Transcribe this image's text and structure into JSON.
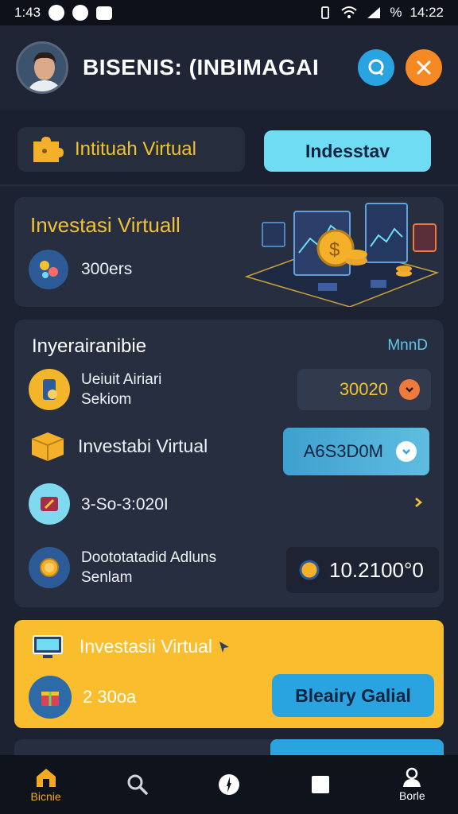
{
  "status_bar": {
    "time_left": "1:43",
    "battery": "%",
    "time_right": "14:22"
  },
  "header": {
    "title": "BISENIS: (INBIMAGAI"
  },
  "tabs": {
    "left_label": "Intituah Virtual",
    "right_label": "Indesstav"
  },
  "hero": {
    "title": "Investasi Virtuall",
    "stat": "300ers"
  },
  "panel": {
    "title": "Inyerairanibie",
    "link": "MnnD",
    "rows": [
      {
        "line1": "Ueiuit Airiari",
        "line2": "Sekiom",
        "value": "30020"
      },
      {
        "label": "Investabi Virtual",
        "value": "A6S3D0M"
      },
      {
        "label": "3-So-3:020I"
      },
      {
        "line1": "Doototatadid Adluns",
        "line2": "Senlam",
        "value": "10.2100°0"
      }
    ]
  },
  "promo": {
    "title": "Investasii Virtual",
    "value": "2 30oa",
    "button": "Bleairy Galial"
  },
  "nav": {
    "home": "Bicnie",
    "search": "",
    "compass": "",
    "square": "",
    "profile": "Borle"
  },
  "colors": {
    "accent_yellow": "#f2c232",
    "accent_cyan": "#6fdcf3",
    "accent_orange": "#f58a24",
    "background": "#1c2232"
  }
}
